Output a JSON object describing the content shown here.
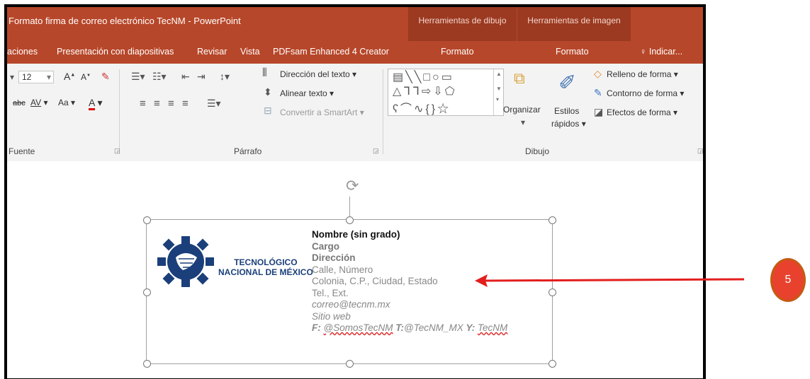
{
  "window": {
    "title": "Formato firma de correo electrónico TecNM - PowerPoint",
    "context_headers": [
      "Herramientas de dibujo",
      "Herramientas de imagen"
    ]
  },
  "tabs": [
    "aciones",
    "Presentación con diapositivas",
    "Revisar",
    "Vista",
    "PDFsam Enhanced 4 Creator",
    "Formato",
    "Formato"
  ],
  "tell_me": "Indicar...",
  "ribbon": {
    "font_size": "12",
    "font_group_label": "Fuente",
    "paragraph_group_label": "Párrafo",
    "drawing_group_label": "Dibujo",
    "text_direction": "Dirección del texto",
    "align_text": "Alinear texto",
    "convert_smartart": "Convertir a SmartArt",
    "organize": "Organizar",
    "quick_styles_1": "Estilos",
    "quick_styles_2": "rápidos",
    "shape_fill": "Relleno de forma",
    "shape_outline": "Contorno de forma",
    "shape_effects": "Efectos de forma",
    "font_case": "Aa",
    "char_spacing": "AV",
    "strike": "abc"
  },
  "logo": {
    "line1": "TECNOLÓGICO",
    "line2": "NACIONAL DE MÉXICO"
  },
  "signature": {
    "name": "Nombre (sin grado)",
    "position": "Cargo",
    "department": "Dirección",
    "street": "Calle, Número",
    "city": "Colonia, C.P., Ciudad, Estado",
    "phone": "Tel., Ext.",
    "email": "correo@tecnm.mx",
    "website": "Sitio web",
    "social_f": "F:",
    "social_f_handle": "@SomosTecNM",
    "social_t": "T:",
    "social_t_handle": "@TecNM_MX",
    "social_y": "Y:",
    "social_y_handle": "TecNM"
  },
  "annotation": {
    "step": "5"
  },
  "colors": {
    "accent": "#b7472a",
    "context_tab": "#9b3a21",
    "arrow": "#e31e1e",
    "badge_border": "#c55a11",
    "badge_fill": "#e8422f",
    "logo_blue": "#1b3f7a"
  }
}
